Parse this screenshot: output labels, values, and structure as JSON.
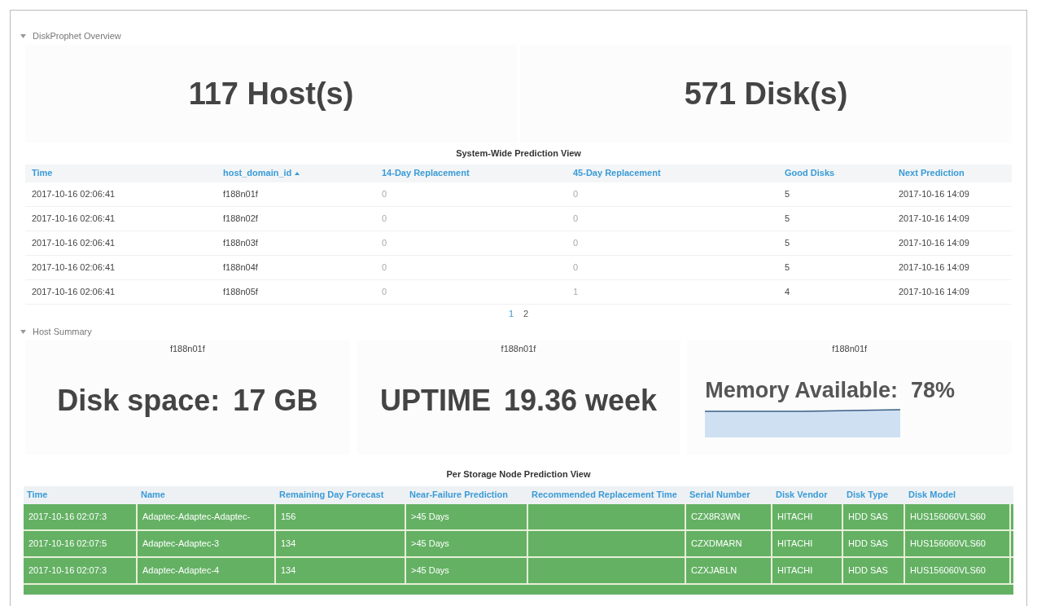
{
  "overview": {
    "title": "DiskProphet Overview",
    "expanded": true,
    "stats": [
      "117 Host(s)",
      "571 Disk(s)"
    ],
    "table": {
      "title": "System-Wide Prediction View",
      "columns": [
        {
          "label": "Time",
          "sorted": false
        },
        {
          "label": "host_domain_id",
          "sorted": true
        },
        {
          "label": "14-Day Replacement",
          "sorted": false
        },
        {
          "label": "45-Day Replacement",
          "sorted": false
        },
        {
          "label": "Good Disks",
          "sorted": false
        },
        {
          "label": "Next Prediction",
          "sorted": false
        }
      ],
      "rows": [
        [
          "2017-10-16 02:06:41",
          "f188n01f",
          "0",
          "0",
          "5",
          "2017-10-16 14:09"
        ],
        [
          "2017-10-16 02:06:41",
          "f188n02f",
          "0",
          "0",
          "5",
          "2017-10-16 14:09"
        ],
        [
          "2017-10-16 02:06:41",
          "f188n03f",
          "0",
          "0",
          "5",
          "2017-10-16 14:09"
        ],
        [
          "2017-10-16 02:06:41",
          "f188n04f",
          "0",
          "0",
          "5",
          "2017-10-16 14:09"
        ],
        [
          "2017-10-16 02:06:41",
          "f188n05f",
          "0",
          "1",
          "4",
          "2017-10-16 14:09"
        ]
      ],
      "pages": [
        {
          "label": "1",
          "selected": true
        },
        {
          "label": "2",
          "selected": false
        }
      ]
    }
  },
  "host_summary": {
    "title": "Host Summary",
    "expanded": true,
    "cards": [
      {
        "host": "f188n01f",
        "label": "Disk space:",
        "value": "17 GB",
        "kind": "plain"
      },
      {
        "host": "f188n01f",
        "label": "UPTIME",
        "value": "19.36 week",
        "kind": "plain"
      },
      {
        "host": "f188n01f",
        "label": "Memory Available:",
        "value": "78%",
        "kind": "sparkline"
      }
    ],
    "table": {
      "title": "Per Storage Node Prediction View",
      "columns": [
        "Time",
        "Name",
        "Remaining Day Forecast",
        "Near-Failure Prediction",
        "Recommended Replacement Time",
        "Serial Number",
        "Disk Vendor",
        "Disk Type",
        "Disk Model"
      ],
      "rows": [
        {
          "color": "#64b164",
          "cells": [
            "2017-10-16 02:07:3",
            "Adaptec-Adaptec-Adaptec-",
            "156",
            ">45 Days",
            "",
            "CZX8R3WN",
            "HITACHI",
            "HDD SAS",
            "HUS156060VLS60"
          ]
        },
        {
          "color": "#64b164",
          "cells": [
            "2017-10-16 02:07:5",
            "Adaptec-Adaptec-3",
            "134",
            ">45 Days",
            "",
            "CZXDMARN",
            "HITACHI",
            "HDD SAS",
            "HUS156060VLS60"
          ]
        },
        {
          "color": "#64b164",
          "cells": [
            "2017-10-16 02:07:3",
            "Adaptec-Adaptec-4",
            "134",
            ">45 Days",
            "",
            "CZXJABLN",
            "HITACHI",
            "HDD SAS",
            "HUS156060VLS60"
          ]
        }
      ]
    }
  }
}
